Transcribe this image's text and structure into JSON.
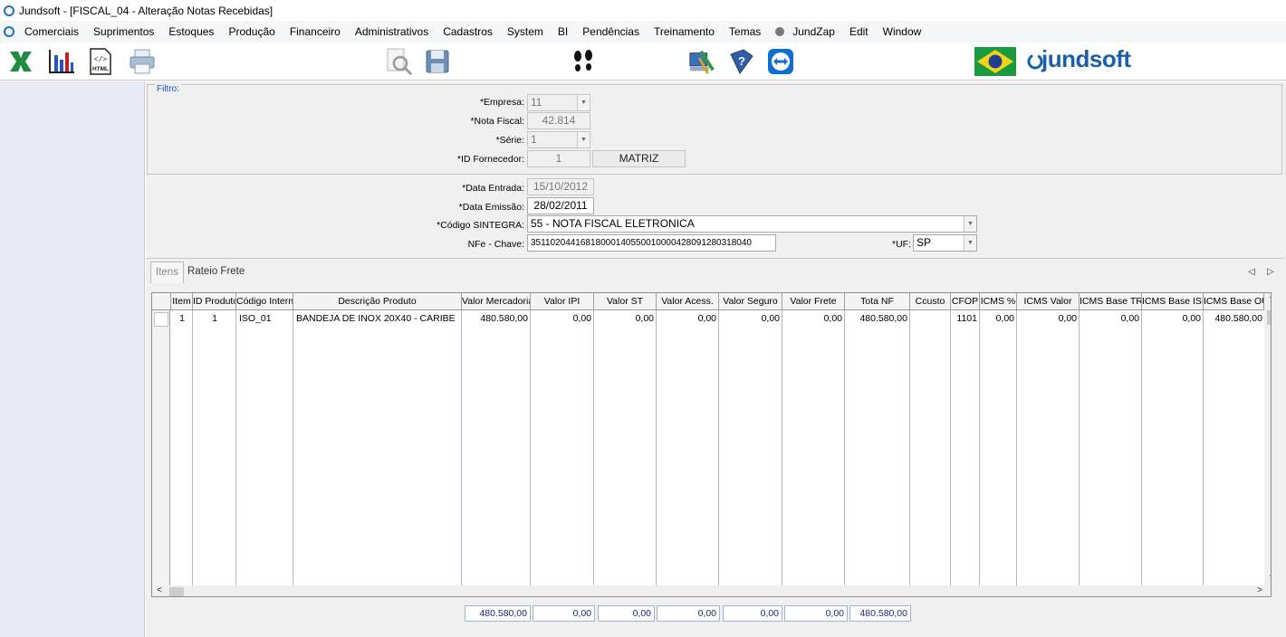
{
  "window": {
    "title": "Jundsoft - [FISCAL_04 - Alteração Notas Recebidas]"
  },
  "menu": [
    "Comerciais",
    "Suprimentos",
    "Estoques",
    "Produção",
    "Financeiro",
    "Administrativos",
    "Cadastros",
    "System",
    "BI",
    "Pendências",
    "Treinamento",
    "Temas",
    "JundZap",
    "Edit",
    "Window"
  ],
  "toolbar": {
    "html_icon_text": "HTML",
    "logo_text": "jundsoft",
    "icons": [
      "excel-export-icon",
      "chart-icon",
      "html-export-icon",
      "print-icon",
      "print-preview-icon",
      "save-icon",
      "footprints-icon",
      "tools-icon",
      "help-book-icon",
      "teamviewer-icon",
      "brazil-flag-icon",
      "jundsoft-logo-icon"
    ]
  },
  "filter": {
    "legend": "Filtro:",
    "empresa_label": "*Empresa:",
    "empresa_value": "11",
    "nota_label": "*Nota Fiscal:",
    "nota_value": "42.814",
    "serie_label": "*Série:",
    "serie_value": "1",
    "fornecedor_label": "*ID Fornecedor:",
    "fornecedor_value": "1",
    "fornecedor_name": "MATRIZ"
  },
  "form": {
    "data_entrada_label": "*Data Entrada:",
    "data_entrada_value": "15/10/2012",
    "data_emissao_label": "*Data Emissão:",
    "data_emissao_value": "28/02/2011",
    "sintegra_label": "*Código SINTEGRA:",
    "sintegra_value": "55 - NOTA FISCAL ELETRONICA",
    "chave_label": "NFe - Chave:",
    "chave_value": "35110204416818000140550010000428091280318040",
    "uf_label": "*UF:",
    "uf_value": "SP"
  },
  "tabs": [
    "Itens",
    "Rateio Frete"
  ],
  "grid": {
    "columns": [
      "Item",
      "ID Produto",
      "Código Interno",
      "Descrição Produto",
      "Valor Mercadoria",
      "Valor IPI",
      "Valor ST",
      "Valor Acess.",
      "Valor Seguro",
      "Valor Frete",
      "Tota NF",
      "Ccusto",
      "CFOP",
      "ICMS %",
      "ICMS Valor",
      "ICMS Base TRI",
      "ICMS Base ISE",
      "ICMS Base OU"
    ],
    "rows": [
      [
        "1",
        "1",
        "ISO_01",
        "BANDEJA DE INOX 20X40 - CARIBE",
        "480.580,00",
        "0,00",
        "0,00",
        "0,00",
        "0,00",
        "0,00",
        "480.580,00",
        "",
        "1101",
        "0,00",
        "0,00",
        "0,00",
        "0,00",
        "480.580,00"
      ]
    ]
  },
  "totals": [
    "480.580,00",
    "0,00",
    "0,00",
    "0,00",
    "0,00",
    "0,00",
    "480.580,00"
  ]
}
